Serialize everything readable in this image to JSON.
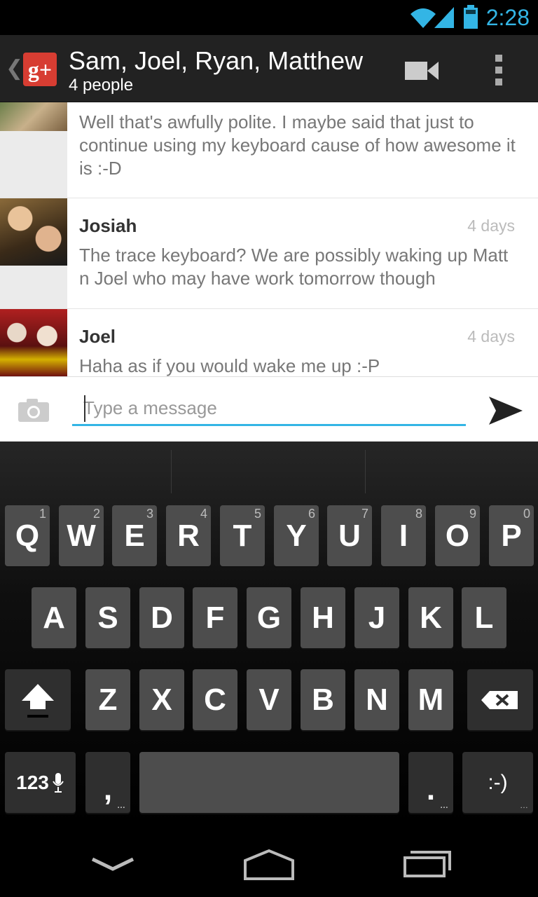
{
  "status_bar": {
    "time": "2:28"
  },
  "action_bar": {
    "title": "Sam, Joel, Ryan, Matthew",
    "subtitle": "4 people"
  },
  "messages": [
    {
      "sender": "",
      "time": "",
      "text": "Well that's awfully polite. I maybe said that just to continue using my keyboard cause of how awesome it is :-D"
    },
    {
      "sender": "Josiah",
      "time": "4 days",
      "text": "The trace keyboard? We are possibly waking up Matt n Joel who may have work tomorrow though"
    },
    {
      "sender": "Joel",
      "time": "4 days",
      "text": "Haha as if you would wake me up :-P"
    }
  ],
  "compose": {
    "placeholder": "Type a message"
  },
  "keyboard": {
    "row1": [
      {
        "label": "Q",
        "hint": "1"
      },
      {
        "label": "W",
        "hint": "2"
      },
      {
        "label": "E",
        "hint": "3"
      },
      {
        "label": "R",
        "hint": "4"
      },
      {
        "label": "T",
        "hint": "5"
      },
      {
        "label": "Y",
        "hint": "6"
      },
      {
        "label": "U",
        "hint": "7"
      },
      {
        "label": "I",
        "hint": "8"
      },
      {
        "label": "O",
        "hint": "9"
      },
      {
        "label": "P",
        "hint": "0"
      }
    ],
    "row2": [
      "A",
      "S",
      "D",
      "F",
      "G",
      "H",
      "J",
      "K",
      "L"
    ],
    "row3": [
      "Z",
      "X",
      "C",
      "V",
      "B",
      "N",
      "M"
    ],
    "symbols_label": "123",
    "comma_label": ",",
    "period_label": ".",
    "smiley_label": ":-)"
  }
}
